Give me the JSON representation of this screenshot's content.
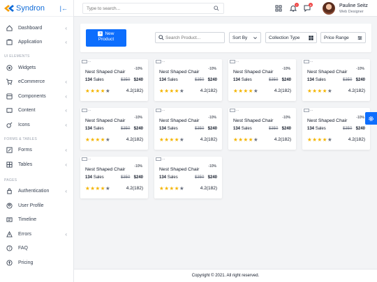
{
  "brand": {
    "name": "Syndron"
  },
  "topbar": {
    "search_placeholder": "Type to search...",
    "notifications_badge": "7",
    "messages_badge": "8",
    "user_name": "Pauline Seitz",
    "user_role": "Web Designer"
  },
  "sidebar": {
    "items": [
      {
        "label": "Dashboard",
        "icon": "home-icon",
        "chev": "‹"
      },
      {
        "label": "Application",
        "icon": "folder-icon",
        "chev": "‹"
      }
    ],
    "section_ui": "UI ELEMENTS",
    "ui_items": [
      {
        "label": "Widgets",
        "icon": "widgets-icon",
        "chev": ""
      },
      {
        "label": "eCommerce",
        "icon": "cart-icon",
        "chev": "‹"
      },
      {
        "label": "Components",
        "icon": "components-icon",
        "chev": "‹"
      },
      {
        "label": "Content",
        "icon": "content-icon",
        "chev": "‹"
      },
      {
        "label": "Icons",
        "icon": "icons-icon",
        "chev": "‹"
      }
    ],
    "section_forms": "FORMS & TABLES",
    "form_items": [
      {
        "label": "Forms",
        "icon": "forms-icon",
        "chev": "‹"
      },
      {
        "label": "Tables",
        "icon": "tables-icon",
        "chev": "‹"
      }
    ],
    "section_pages": "PAGES",
    "page_items": [
      {
        "label": "Authentication",
        "icon": "lock-icon",
        "chev": "‹"
      },
      {
        "label": "User Profile",
        "icon": "user-icon",
        "chev": ""
      },
      {
        "label": "Timeline",
        "icon": "timeline-icon",
        "chev": ""
      },
      {
        "label": "Errors",
        "icon": "warning-icon",
        "chev": "‹"
      },
      {
        "label": "FAQ",
        "icon": "question-icon",
        "chev": ""
      },
      {
        "label": "Pricing",
        "icon": "pricing-icon",
        "chev": ""
      }
    ]
  },
  "filters": {
    "new_product_line1": "New",
    "new_product_line2": "Product",
    "search_placeholder": "Search Product...",
    "sort_label": "Sort By",
    "collection_label": "Collection Type",
    "price_label": "Price Range"
  },
  "products": [
    {
      "image_alt": "...",
      "title": "Nest Shaped Chair",
      "discount": "-10%",
      "sales_count": "134",
      "sales_label": "Sales",
      "old_price": "$350",
      "price": "$240",
      "stars": 4,
      "rating": "4.2(182)"
    },
    {
      "image_alt": "...",
      "title": "Nest Shaped Chair",
      "discount": "-10%",
      "sales_count": "134",
      "sales_label": "Sales",
      "old_price": "$350",
      "price": "$240",
      "stars": 4,
      "rating": "4.2(182)"
    },
    {
      "image_alt": "...",
      "title": "Nest Shaped Chair",
      "discount": "-10%",
      "sales_count": "134",
      "sales_label": "Sales",
      "old_price": "$350",
      "price": "$240",
      "stars": 4,
      "rating": "4.2(182)"
    },
    {
      "image_alt": "...",
      "title": "Nest Shaped Chair",
      "discount": "-10%",
      "sales_count": "134",
      "sales_label": "Sales",
      "old_price": "$350",
      "price": "$240",
      "stars": 4,
      "rating": "4.2(182)"
    },
    {
      "image_alt": "...",
      "title": "Nest Shaped Chair",
      "discount": "-10%",
      "sales_count": "134",
      "sales_label": "Sales",
      "old_price": "$350",
      "price": "$240",
      "stars": 4,
      "rating": "4.2(182)"
    },
    {
      "image_alt": "...",
      "title": "Nest Shaped Chair",
      "discount": "-10%",
      "sales_count": "134",
      "sales_label": "Sales",
      "old_price": "$350",
      "price": "$240",
      "stars": 4,
      "rating": "4.2(182)"
    },
    {
      "image_alt": "...",
      "title": "Nest Shaped Chair",
      "discount": "-10%",
      "sales_count": "134",
      "sales_label": "Sales",
      "old_price": "$350",
      "price": "$240",
      "stars": 4,
      "rating": "4.2(182)"
    },
    {
      "image_alt": "...",
      "title": "Nest Shaped Chair",
      "discount": "-10%",
      "sales_count": "134",
      "sales_label": "Sales",
      "old_price": "$350",
      "price": "$240",
      "stars": 4,
      "rating": "4.2(182)"
    },
    {
      "image_alt": "...",
      "title": "Nest Shaped Chair",
      "discount": "-10%",
      "sales_count": "134",
      "sales_label": "Sales",
      "old_price": "$350",
      "price": "$240",
      "stars": 4,
      "rating": "4.2(182)"
    },
    {
      "image_alt": "...",
      "title": "Nest Shaped Chair",
      "discount": "-10%",
      "sales_count": "134",
      "sales_label": "Sales",
      "old_price": "$350",
      "price": "$240",
      "stars": 4,
      "rating": "4.2(182)"
    }
  ],
  "footer": {
    "copyright": "Copyright © 2021. All right reserved."
  },
  "colors": {
    "accent": "#0d6efd",
    "brand": "#0f6bd8",
    "star": "#f4b400"
  }
}
